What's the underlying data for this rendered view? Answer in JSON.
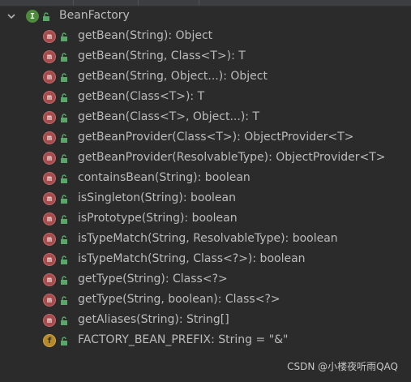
{
  "tree": {
    "root": {
      "label": "BeanFactory",
      "icon": "interface-icon",
      "badge": "I"
    },
    "members": [
      {
        "label": "getBean(String): Object",
        "kind": "method",
        "badge": "m"
      },
      {
        "label": "getBean(String, Class<T>): T",
        "kind": "method",
        "badge": "m"
      },
      {
        "label": "getBean(String, Object...): Object",
        "kind": "method",
        "badge": "m"
      },
      {
        "label": "getBean(Class<T>): T",
        "kind": "method",
        "badge": "m"
      },
      {
        "label": "getBean(Class<T>, Object...): T",
        "kind": "method",
        "badge": "m"
      },
      {
        "label": "getBeanProvider(Class<T>): ObjectProvider<T>",
        "kind": "method",
        "badge": "m"
      },
      {
        "label": "getBeanProvider(ResolvableType): ObjectProvider<T>",
        "kind": "method",
        "badge": "m"
      },
      {
        "label": "containsBean(String): boolean",
        "kind": "method",
        "badge": "m"
      },
      {
        "label": "isSingleton(String): boolean",
        "kind": "method",
        "badge": "m"
      },
      {
        "label": "isPrototype(String): boolean",
        "kind": "method",
        "badge": "m"
      },
      {
        "label": "isTypeMatch(String, ResolvableType): boolean",
        "kind": "method",
        "badge": "m"
      },
      {
        "label": "isTypeMatch(String, Class<?>): boolean",
        "kind": "method",
        "badge": "m"
      },
      {
        "label": "getType(String): Class<?>",
        "kind": "method",
        "badge": "m"
      },
      {
        "label": "getType(String, boolean): Class<?>",
        "kind": "method",
        "badge": "m"
      },
      {
        "label": "getAliases(String): String[]",
        "kind": "method",
        "badge": "m"
      },
      {
        "label": "FACTORY_BEAN_PREFIX: String = \"&\"",
        "kind": "field",
        "badge": "f"
      }
    ]
  },
  "watermark": "CSDN @小楼夜听雨QAQ",
  "colors": {
    "background": "#2b2b2b",
    "text": "#bbbbbb",
    "interface_badge": "#4e8a3b",
    "method_badge": "#a64c4c",
    "field_badge": "#b58a2b",
    "public_lock": "#59a869"
  }
}
